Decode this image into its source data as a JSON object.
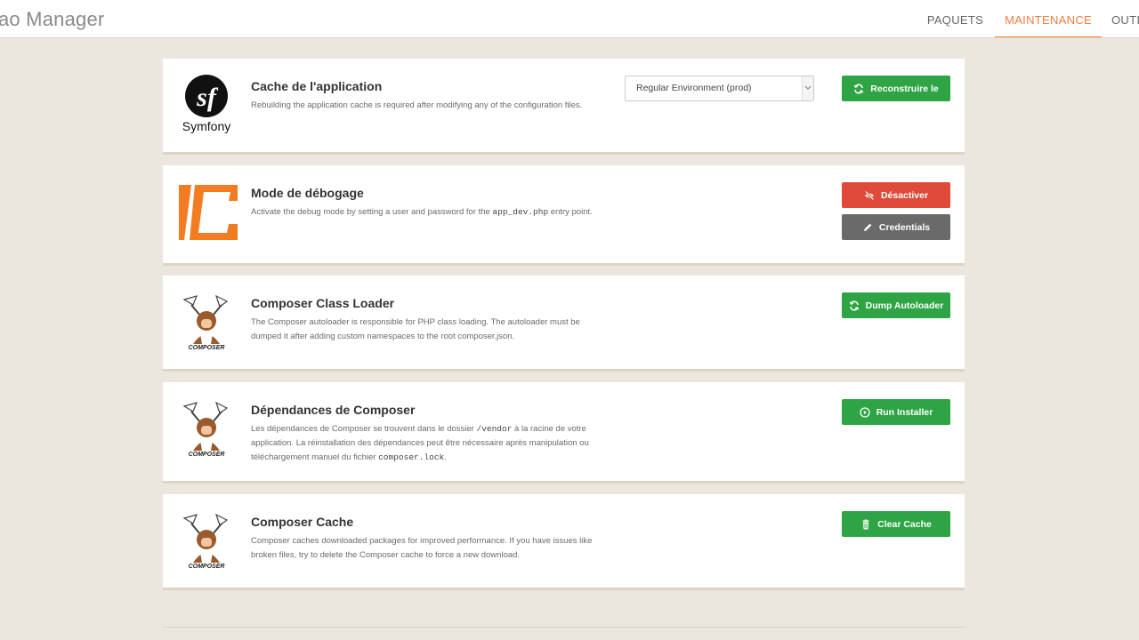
{
  "app": {
    "title": "ao Manager"
  },
  "nav": {
    "items": [
      "PAQUETS",
      "MAINTENANCE",
      "OUTI"
    ]
  },
  "cards": {
    "cache": {
      "logo_text": "Symfony",
      "title": "Cache de l'application",
      "description": "Rebuilding the application cache is required after modifying any of the configuration files.",
      "environment_select": "Regular Environment (prod)",
      "button": "Reconstruire le"
    },
    "debug": {
      "title": "Mode de débogage",
      "desc_before": "Activate the debug mode by setting a user and password for the ",
      "desc_code": "app_dev.php",
      "desc_after": " entry point.",
      "button_disable": "Désactiver",
      "button_credentials": "Credentials"
    },
    "classloader": {
      "logo_text": "COMPOSER",
      "title": "Composer Class Loader",
      "description": "The Composer autoloader is responsible for PHP class loading. The autoloader must be dumped it after adding custom namespaces to the root composer.json.",
      "button": "Dump Autoloader"
    },
    "dependencies": {
      "logo_text": "COMPOSER",
      "title": "Dépendances de Composer",
      "desc_1": "Les dépendances de Composer se trouvent dans le dossier ",
      "desc_code_1": "/vendor",
      "desc_2": " à la racine de votre application. La réinstallation des dépendances peut être nécessaire après manipulation ou téléchargement manuel du fichier ",
      "desc_code_2": "composer.lock",
      "desc_3": ".",
      "button": "Run Installer"
    },
    "composercache": {
      "logo_text": "COMPOSER",
      "title": "Composer Cache",
      "description": "Composer caches downloaded packages for improved performance. If you have issues like broken files, try to delete the Composer cache to force a new download.",
      "button": "Clear Cache"
    }
  },
  "colors": {
    "accent": "#f47c3c",
    "green": "#2ea444",
    "red": "#e04a3a",
    "gray": "#6a6a6a",
    "background": "#ebe7df"
  }
}
